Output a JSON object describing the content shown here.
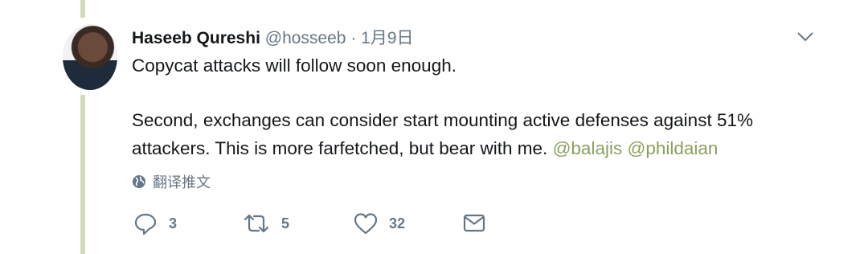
{
  "tweet": {
    "author_name": "Haseeb Qureshi",
    "handle": "@hosseeb",
    "separator": "·",
    "date": "1月9日",
    "text_line1": "Copycat attacks will follow soon enough.",
    "text_para2": "Second, exchanges can consider start mounting active defenses against 51% attackers. This is more farfetched, but bear with me.",
    "mentions": [
      "@balajis",
      "@phildaian"
    ],
    "translate_label": "翻译推文"
  },
  "actions": {
    "reply_count": "3",
    "retweet_count": "5",
    "like_count": "32"
  },
  "colors": {
    "thread_line": "#d2dcb6",
    "mention": "#8aa05c",
    "muted": "#657786"
  },
  "icons": [
    "chevron-down-icon",
    "globe-icon",
    "reply-icon",
    "retweet-icon",
    "like-icon",
    "message-icon"
  ]
}
